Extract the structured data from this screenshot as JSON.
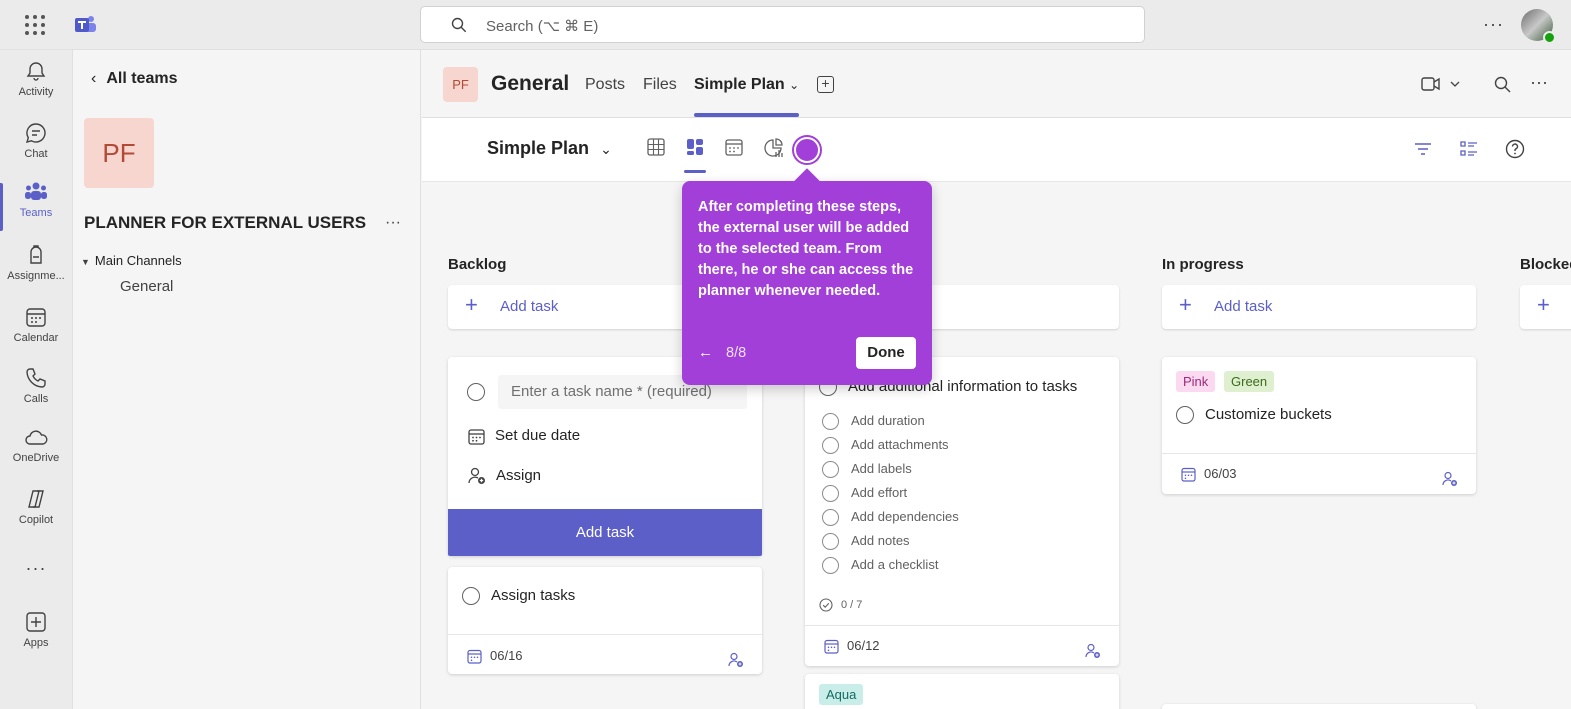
{
  "topbar": {
    "search_placeholder": "Search (⌥ ⌘ E)"
  },
  "rail": {
    "items": [
      {
        "label": "Activity",
        "icon": "bell-icon"
      },
      {
        "label": "Chat",
        "icon": "chat-icon"
      },
      {
        "label": "Teams",
        "icon": "teams-icon",
        "active": true
      },
      {
        "label": "Assignme...",
        "icon": "assignments-icon"
      },
      {
        "label": "Calendar",
        "icon": "calendar-icon"
      },
      {
        "label": "Calls",
        "icon": "phone-icon"
      },
      {
        "label": "OneDrive",
        "icon": "cloud-icon"
      },
      {
        "label": "Copilot",
        "icon": "copilot-icon"
      },
      {
        "label": "Apps",
        "icon": "apps-icon"
      }
    ]
  },
  "panel": {
    "back_label": "All teams",
    "team_initials": "PF",
    "team_name": "PLANNER FOR EXTERNAL USERS",
    "channels_header": "Main Channels",
    "channel": "General"
  },
  "header": {
    "initials": "PF",
    "channel_title": "General",
    "tabs": [
      {
        "label": "Posts"
      },
      {
        "label": "Files"
      },
      {
        "label": "Simple Plan",
        "active": true
      }
    ]
  },
  "plan": {
    "title": "Simple Plan"
  },
  "board": {
    "buckets": [
      {
        "title": "Backlog",
        "add_label": "Add task"
      },
      {
        "title": "",
        "add_label": ""
      },
      {
        "title": "In progress",
        "add_label": "Add task"
      },
      {
        "title": "Blocked",
        "add_label": ""
      }
    ],
    "new_task": {
      "placeholder": "Enter a task name * (required)",
      "due_label": "Set due date",
      "assign_label": "Assign",
      "submit_label": "Add task"
    },
    "assign_card": {
      "title": "Assign tasks",
      "date": "06/16"
    },
    "info_card": {
      "title": "Add additional information to tasks",
      "checklist": [
        "Add duration",
        "Add attachments",
        "Add labels",
        "Add effort",
        "Add dependencies",
        "Add notes",
        "Add a checklist"
      ],
      "progress": "0 / 7",
      "date": "06/12"
    },
    "aqua_card": {
      "label": "Aqua"
    },
    "progress_card": {
      "labels": [
        {
          "text": "Pink",
          "bg": "#fbd9f0",
          "fg": "#9c2a77"
        },
        {
          "text": "Green",
          "bg": "#dff0d0",
          "fg": "#3b6b1b"
        }
      ],
      "title": "Customize buckets",
      "date": "06/03"
    }
  },
  "tooltip": {
    "text": "After completing these steps, the external user will be added to the selected team. From there, he or she can access the planner whenever needed.",
    "step": "8/8",
    "done_label": "Done"
  },
  "colors": {
    "brand": "#5b5fc7",
    "tooltip": "#a13fd8"
  }
}
